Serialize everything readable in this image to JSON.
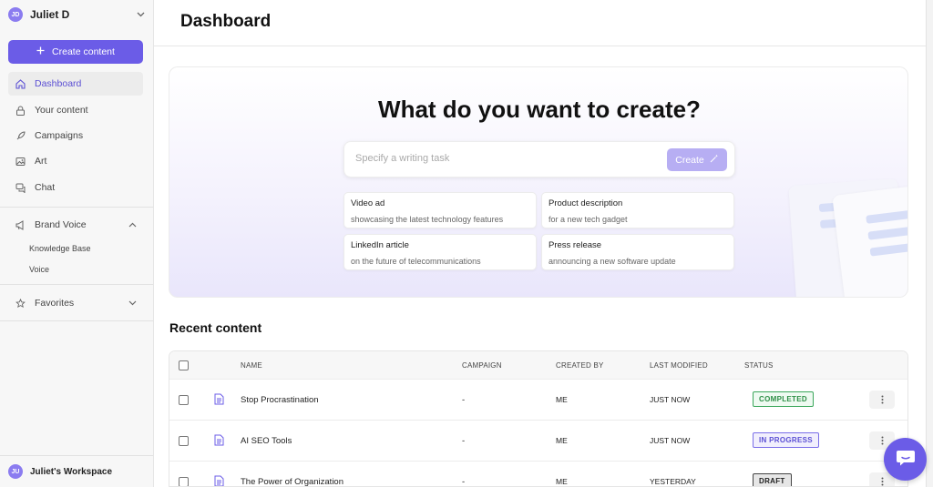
{
  "colors": {
    "accent": "#6b5ce7",
    "completed": "#3aa65a",
    "in_progress": "#7a6ee8",
    "draft": "#444444"
  },
  "sidebar": {
    "user": {
      "initials": "JD",
      "name": "Juliet D"
    },
    "create_label": "Create content",
    "items": [
      {
        "label": "Dashboard",
        "icon": "home-icon",
        "active": true
      },
      {
        "label": "Your content",
        "icon": "lock-icon"
      },
      {
        "label": "Campaigns",
        "icon": "rocket-icon"
      },
      {
        "label": "Art",
        "icon": "image-icon"
      },
      {
        "label": "Chat",
        "icon": "chat-icon"
      }
    ],
    "brand_voice": {
      "label": "Brand Voice",
      "icon": "megaphone-icon",
      "children": [
        "Knowledge Base",
        "Voice"
      ]
    },
    "favorites": {
      "label": "Favorites",
      "icon": "star-icon"
    },
    "workspace": {
      "initials": "JU",
      "name": "Juliet's Workspace"
    }
  },
  "header": {
    "title": "Dashboard"
  },
  "hero": {
    "title": "What do you want to create?",
    "input_placeholder": "Specify a writing task",
    "create_label": "Create",
    "suggestions": [
      {
        "title": "Video ad",
        "desc": "showcasing the latest technology features"
      },
      {
        "title": "Product description",
        "desc": "for a new tech gadget"
      },
      {
        "title": "LinkedIn article",
        "desc": "on the future of telecommunications"
      },
      {
        "title": "Press release",
        "desc": "announcing a new software update"
      }
    ]
  },
  "recent": {
    "title": "Recent content",
    "columns": [
      "NAME",
      "CAMPAIGN",
      "CREATED BY",
      "LAST MODIFIED",
      "STATUS"
    ],
    "rows": [
      {
        "name": "Stop Procrastination",
        "campaign": "-",
        "created_by": "ME",
        "modified": "JUST NOW",
        "status": "COMPLETED"
      },
      {
        "name": "AI SEO Tools",
        "campaign": "-",
        "created_by": "ME",
        "modified": "JUST NOW",
        "status": "IN PROGRESS"
      },
      {
        "name": "The Power of Organization",
        "campaign": "-",
        "created_by": "ME",
        "modified": "YESTERDAY",
        "status": "DRAFT"
      }
    ]
  }
}
